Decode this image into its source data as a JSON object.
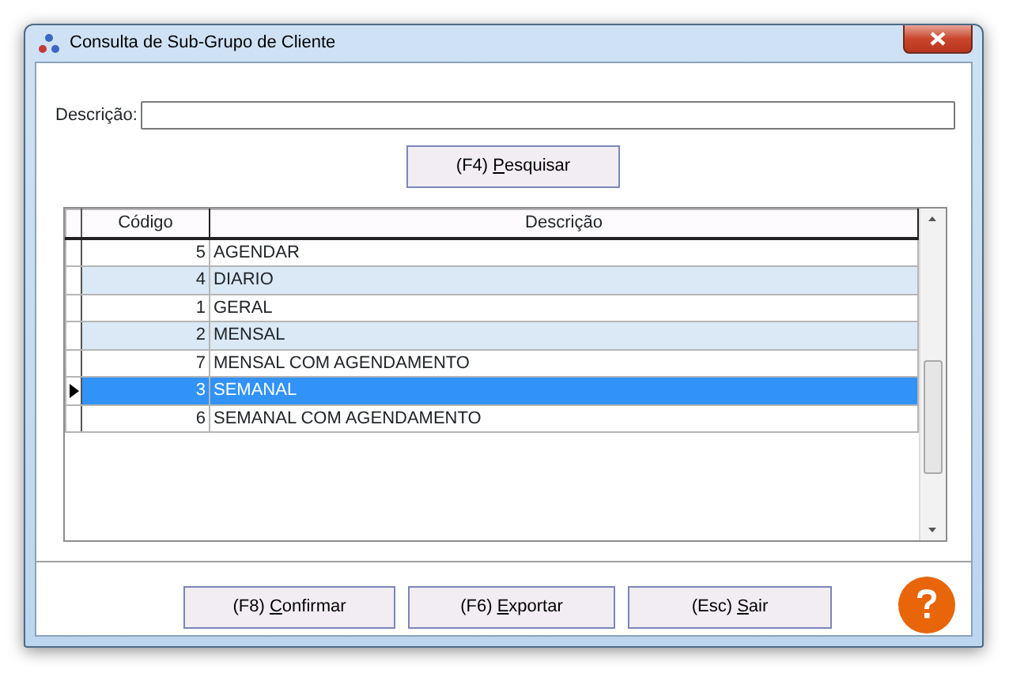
{
  "window": {
    "title": "Consulta de Sub-Grupo de Cliente"
  },
  "filter": {
    "label": "Descrição:"
  },
  "search_button": {
    "before": "(F4) ",
    "underlined": "P",
    "after": "esquisar"
  },
  "table": {
    "columns": [
      "Código",
      "Descrição"
    ],
    "rows": [
      {
        "codigo": "5",
        "descricao": "AGENDAR",
        "selected": false
      },
      {
        "codigo": "4",
        "descricao": "DIARIO",
        "selected": false
      },
      {
        "codigo": "1",
        "descricao": "GERAL",
        "selected": false
      },
      {
        "codigo": "2",
        "descricao": "MENSAL",
        "selected": false
      },
      {
        "codigo": "7",
        "descricao": "MENSAL COM AGENDAMENTO",
        "selected": false
      },
      {
        "codigo": "3",
        "descricao": "SEMANAL",
        "selected": true
      },
      {
        "codigo": "6",
        "descricao": "SEMANAL COM AGENDAMENTO",
        "selected": false
      }
    ]
  },
  "buttons": [
    {
      "before": "(F8) ",
      "underlined": "C",
      "after": "onfirmar"
    },
    {
      "before": "(F6) ",
      "underlined": "E",
      "after": "xportar"
    },
    {
      "before": "(Esc) ",
      "underlined": "S",
      "after": "air"
    }
  ]
}
